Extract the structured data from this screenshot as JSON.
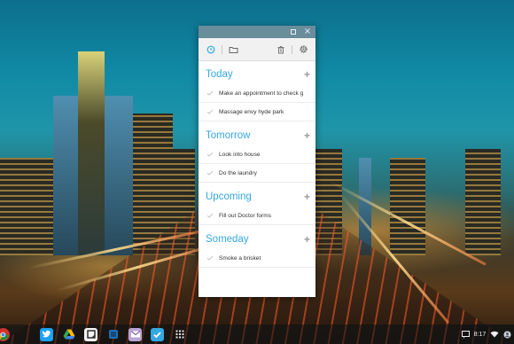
{
  "window": {
    "buttons": {
      "maximize_icon": "maximize-icon",
      "close_icon": "close-icon",
      "close_glyph": "×"
    }
  },
  "toolbar": {
    "icons": [
      "clock-icon",
      "folder-icon",
      "trash-icon",
      "gear-icon"
    ],
    "accent": "#35a8e0"
  },
  "sections": [
    {
      "title": "Today",
      "add": "+",
      "tasks": [
        "Make an appointment to check g",
        "Massage envy hyde park"
      ]
    },
    {
      "title": "Tomorrow",
      "add": "+",
      "tasks": [
        "Look into house",
        "Do the laundry"
      ]
    },
    {
      "title": "Upcoming",
      "add": "+",
      "tasks": [
        "Fill out Doctor forms"
      ]
    },
    {
      "title": "Someday",
      "add": "+",
      "tasks": [
        "Smoke a brisket"
      ]
    }
  ],
  "shelf": {
    "apps": [
      "chrome-icon",
      "twitter-icon",
      "drive-icon",
      "notes-icon",
      "app-icon",
      "yahoo-mail-icon",
      "tasks-app-icon",
      "app-launcher-icon"
    ]
  },
  "tray": {
    "clock": "8:17",
    "icons": [
      "notification-icon",
      "wifi-icon",
      "account-icon"
    ]
  }
}
